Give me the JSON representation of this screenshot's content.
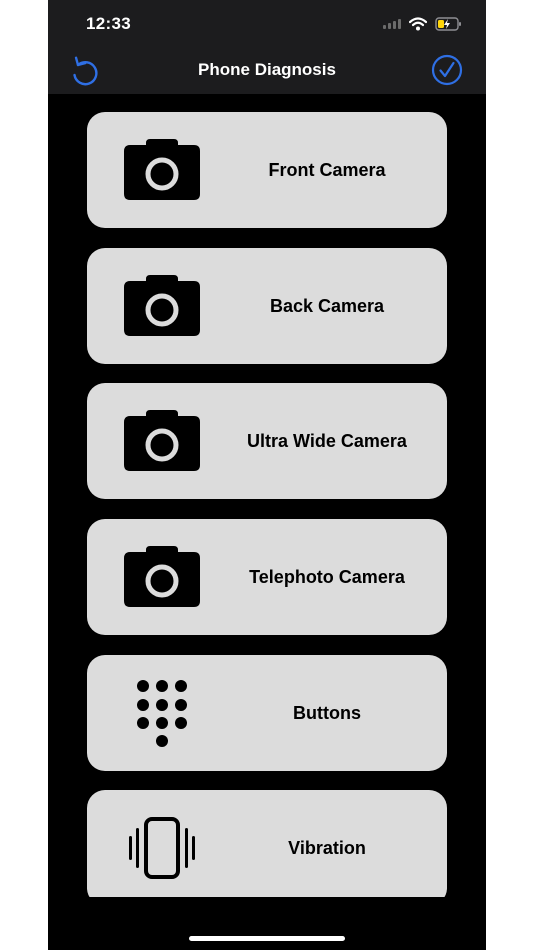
{
  "status": {
    "time": "12:33"
  },
  "navbar": {
    "title": "Phone Diagnosis",
    "left_icon": "undo-icon",
    "right_icon": "checkmark-circle-icon"
  },
  "colors": {
    "accent": "#2f6fe4",
    "card": "#dcdcdc",
    "background": "#000000",
    "navbar": "#1c1c1e"
  },
  "items": [
    {
      "label": "Front Camera",
      "icon": "camera-icon"
    },
    {
      "label": "Back Camera",
      "icon": "camera-icon"
    },
    {
      "label": "Ultra Wide Camera",
      "icon": "camera-icon"
    },
    {
      "label": "Telephoto Camera",
      "icon": "camera-icon"
    },
    {
      "label": "Buttons",
      "icon": "keypad-icon"
    },
    {
      "label": "Vibration",
      "icon": "vibration-icon"
    }
  ]
}
